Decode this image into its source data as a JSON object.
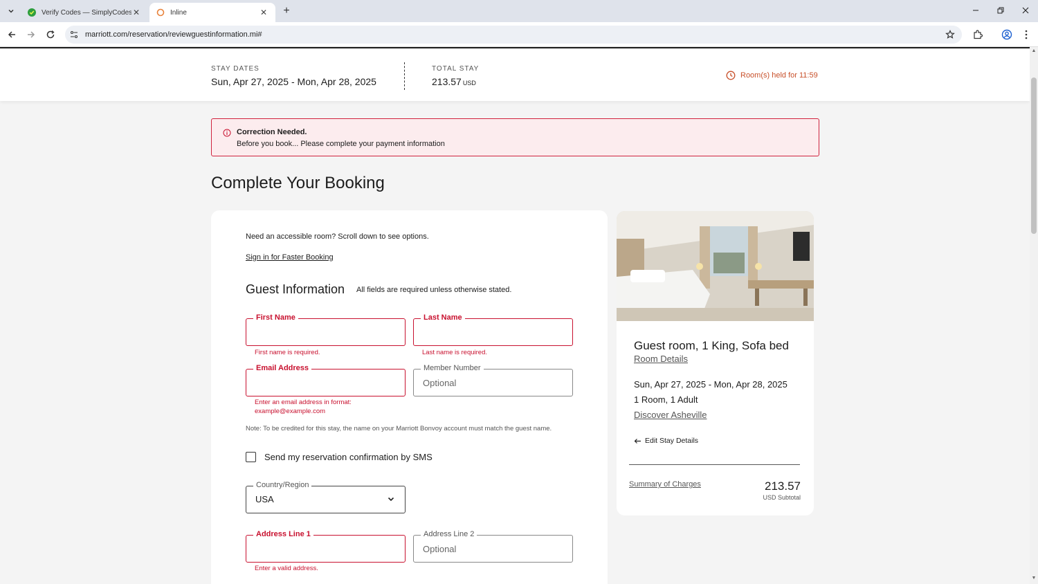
{
  "browser": {
    "tabs": [
      {
        "title": "Verify Codes — SimplyCodes",
        "close": "✕"
      },
      {
        "title": "Inline",
        "close": "✕"
      }
    ],
    "new_tab": "+",
    "url": "marriott.com/reservation/reviewguestinformation.mi#"
  },
  "stay": {
    "dates_label": "STAY DATES",
    "dates_value": "Sun, Apr 27, 2025 - Mon, Apr 28, 2025",
    "total_label": "TOTAL STAY",
    "total_value": "213.57",
    "total_currency": "USD",
    "held_text": "Room(s) held for 11:59"
  },
  "alert": {
    "title": "Correction Needed.",
    "message": "Before you book... Please complete your payment information"
  },
  "page_title": "Complete Your Booking",
  "form": {
    "accessible_note": "Need an accessible room? Scroll down to see options.",
    "sign_in_link": "Sign in for Faster Booking",
    "section_title": "Guest Information",
    "section_subtitle": "All fields are required unless otherwise stated.",
    "first_name": {
      "label": "First Name",
      "value": "",
      "error": "First name is required."
    },
    "last_name": {
      "label": "Last Name",
      "value": "",
      "error": "Last name is required."
    },
    "email": {
      "label": "Email Address",
      "value": "",
      "error_line1": "Enter an email address in format:",
      "error_line2": "example@example.com"
    },
    "member_number": {
      "label": "Member Number",
      "placeholder": "Optional"
    },
    "note": "Note: To be credited for this stay, the name on your Marriott Bonvoy account must match the guest name.",
    "sms_label": "Send my reservation confirmation by SMS",
    "sms_checked": false,
    "country": {
      "label": "Country/Region",
      "value": "USA"
    },
    "address1": {
      "label": "Address Line 1",
      "value": "",
      "error": "Enter a valid address."
    },
    "address2": {
      "label": "Address Line 2",
      "placeholder": "Optional"
    }
  },
  "room": {
    "title": "Guest room, 1 King, Sofa bed",
    "details_link": "Room Details",
    "dates": "Sun, Apr 27, 2025 - Mon, Apr 28, 2025",
    "occupancy": "1 Room, 1 Adult",
    "discover_link": "Discover Asheville",
    "edit_stay": "Edit Stay Details",
    "summary_link": "Summary of Charges",
    "price": "213.57",
    "price_sub": "USD Subtotal"
  },
  "colors": {
    "error": "#c8102e",
    "held_orange": "#c8502a",
    "alert_bg": "#fcecee"
  }
}
